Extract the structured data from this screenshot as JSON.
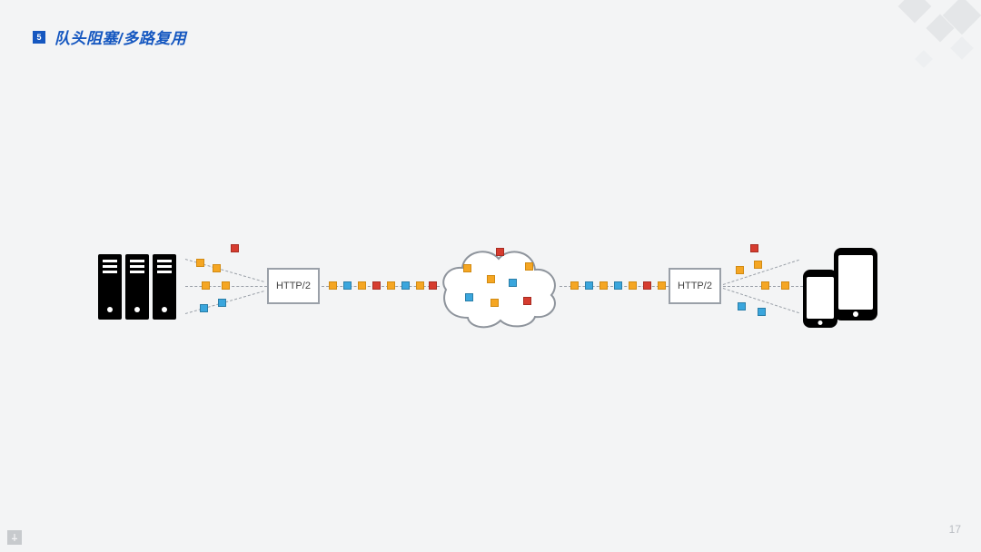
{
  "header": {
    "section_number": "5",
    "title": "队头阻塞/多路复用"
  },
  "page_number": "17",
  "diagram": {
    "box_left_label": "HTTP/2",
    "box_right_label": "HTTP/2",
    "endpoints": {
      "left": "servers",
      "right": "mobile-devices",
      "middle": "cloud"
    },
    "packet_colors": {
      "orange": "#f5a623",
      "red": "#d63c2f",
      "blue": "#3aa6dd"
    },
    "fan_in_left": [
      "orange",
      "orange",
      "red",
      "orange",
      "orange",
      "blue",
      "blue"
    ],
    "stream_left_to_cloud": [
      "orange",
      "blue",
      "orange",
      "red",
      "orange",
      "blue",
      "orange",
      "red"
    ],
    "cloud_scatter": [
      "red",
      "orange",
      "orange",
      "orange",
      "blue",
      "blue",
      "orange",
      "red"
    ],
    "stream_cloud_to_right": [
      "orange",
      "blue",
      "orange",
      "blue",
      "orange",
      "red",
      "orange"
    ],
    "fan_out_right": [
      "red",
      "orange",
      "orange",
      "orange",
      "orange",
      "blue",
      "blue"
    ]
  }
}
